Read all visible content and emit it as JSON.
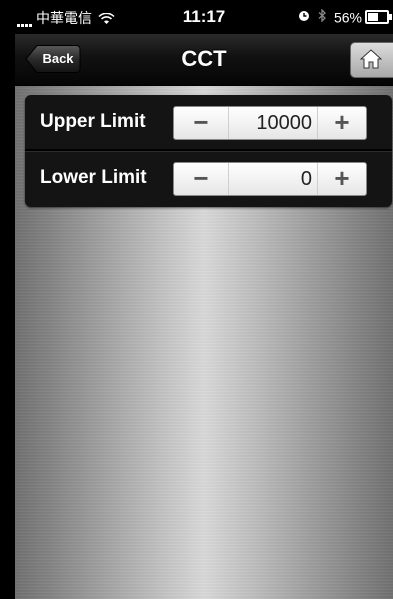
{
  "status_bar": {
    "carrier": "中華電信",
    "time": "11:17",
    "battery_percent": "56%",
    "battery_level": 0.56,
    "icons": [
      "signal-icon",
      "wifi-icon",
      "alarm-clock-icon",
      "bluetooth-icon",
      "battery-icon"
    ]
  },
  "nav": {
    "title": "CCT",
    "back_label": "Back",
    "home_icon": "home-icon"
  },
  "limits": {
    "rows": [
      {
        "label": "Upper Limit",
        "value": "10000",
        "minus": "−",
        "plus": "+"
      },
      {
        "label": "Lower Limit",
        "value": "0",
        "minus": "−",
        "plus": "+"
      }
    ]
  },
  "colors": {
    "nav_background": "#111111",
    "panel_background": "#141414",
    "stepper_background": "#ffffff",
    "metal_background": "#b9b9b9"
  }
}
